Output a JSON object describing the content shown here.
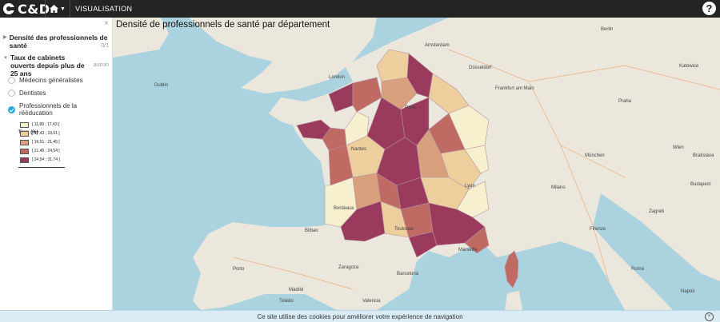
{
  "header": {
    "logo_text": "C&D",
    "home_icon": "home-icon",
    "nav_label": "VISUALISATION",
    "help_label": "?"
  },
  "sidebar": {
    "close_label": "×",
    "section1": {
      "label": "Densité des professionnels de santé",
      "count": "0/1"
    },
    "section2": {
      "label": "Taux de cabinets ouverts depuis plus de 25 ans",
      "status": "aucun"
    },
    "options": [
      {
        "label": "Médecins généralistes",
        "selected": false
      },
      {
        "label": "Dentistes",
        "selected": false
      },
      {
        "label": "Professionnels de la rééducation",
        "selected": true
      }
    ],
    "legend": {
      "title": "Taux (%)",
      "classes": [
        {
          "label": "[ 11,89 ; 17,43 [",
          "color": "#f7f0cf"
        },
        {
          "label": "[ 17,43 ; 19,51 [",
          "color": "#edcf9e"
        },
        {
          "label": "[ 19,51 ; 21,45 [",
          "color": "#d9a07e"
        },
        {
          "label": "[ 21,45 ; 24,54 [",
          "color": "#c06a64"
        },
        {
          "label": "[ 24,54 ; 31,74 ]",
          "color": "#9a3b5e"
        }
      ]
    }
  },
  "map": {
    "title": "Densité de professionnels de santé par département",
    "labels": [
      "Dublin",
      "London",
      "Amsterdam",
      "Düsseldorf",
      "Frankfurt am Main",
      "Berlin",
      "Praha",
      "Katowice",
      "Lyon",
      "Bordeaux",
      "Marseille",
      "Bilbao",
      "Zaragoza",
      "Barcelona",
      "Madrid",
      "Milano",
      "Roma",
      "Firenze",
      "Napoli",
      "Nantes",
      "Paris",
      "Toulouse",
      "Wien",
      "Bratislava",
      "Budapest",
      "Zagreb",
      "Porto",
      "Toledo",
      "Valencia",
      "München"
    ],
    "colors": {
      "sea": "#aad3df",
      "land": "#ece7dc",
      "border": "#b691a3"
    }
  },
  "cookie": {
    "text": "Ce site utilise des cookies pour améliorer votre expérience de navigation",
    "close_label": "×"
  }
}
